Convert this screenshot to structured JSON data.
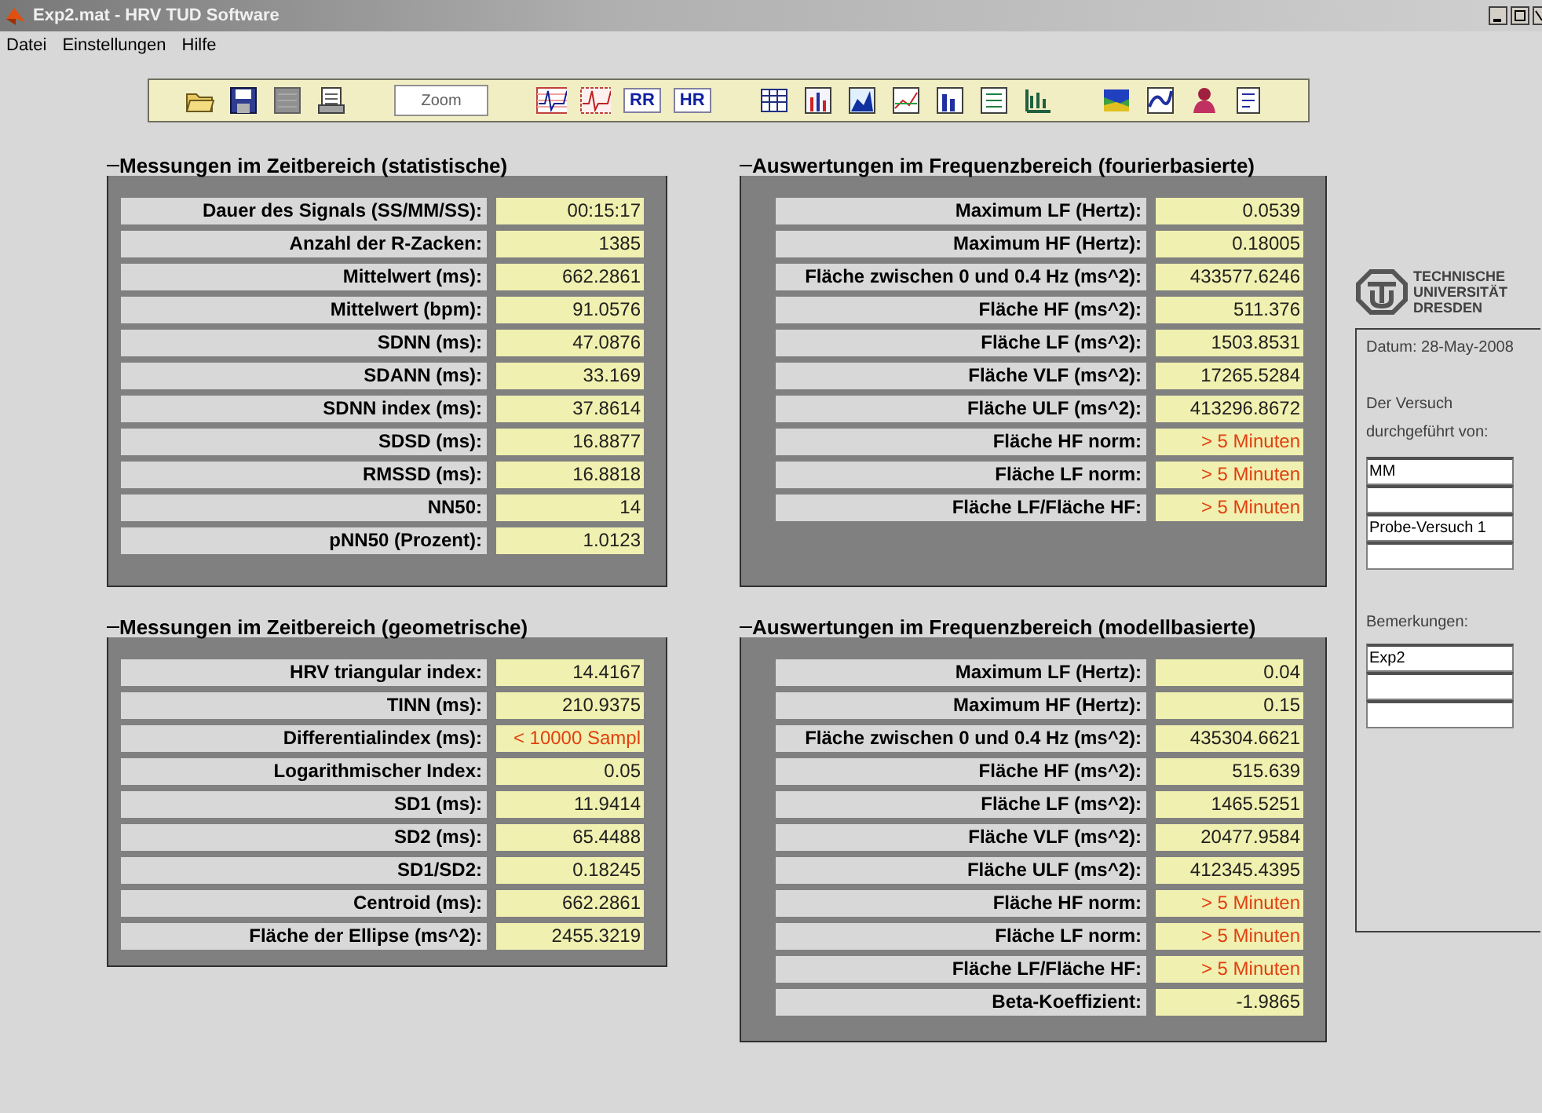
{
  "window": {
    "title": "Exp2.mat - HRV TUD Software"
  },
  "menu": [
    "Datei",
    "Einstellungen",
    "Hilfe"
  ],
  "toolbar": [
    [
      {
        "kind": "icon"
      },
      {
        "kind": "icon"
      },
      {
        "kind": "icon"
      },
      {
        "kind": "icon"
      },
      {
        "kind": "field",
        "label": "Zoom"
      }
    ],
    [
      {
        "kind": "icon"
      },
      {
        "kind": "icon"
      },
      {
        "kind": "text",
        "label": "RR"
      },
      {
        "kind": "text",
        "label": "HR"
      }
    ],
    [
      {
        "kind": "icon"
      },
      {
        "kind": "icon"
      },
      {
        "kind": "icon"
      },
      {
        "kind": "icon"
      },
      {
        "kind": "icon"
      },
      {
        "kind": "icon"
      },
      {
        "kind": "icon"
      }
    ],
    [
      {
        "kind": "icon"
      },
      {
        "kind": "icon"
      },
      {
        "kind": "icon"
      },
      {
        "kind": "icon"
      }
    ]
  ],
  "panels": [
    {
      "title": "Messungen im Zeitbereich (statistische)",
      "rows": [
        {
          "label": "Dauer des Signals (SS/MM/SS):",
          "value": "00:15:17",
          "warning": false
        },
        {
          "label": "Anzahl der R-Zacken:",
          "value": "1385",
          "warning": false
        },
        {
          "label": "Mittelwert (ms):",
          "value": "662.2861",
          "warning": false
        },
        {
          "label": "Mittelwert (bpm):",
          "value": "91.0576",
          "warning": false
        },
        {
          "label": "SDNN (ms):",
          "value": "47.0876",
          "warning": false
        },
        {
          "label": "SDANN (ms):",
          "value": "33.169",
          "warning": false
        },
        {
          "label": "SDNN index (ms):",
          "value": "37.8614",
          "warning": false
        },
        {
          "label": "SDSD (ms):",
          "value": "16.8877",
          "warning": false
        },
        {
          "label": "RMSSD (ms):",
          "value": "16.8818",
          "warning": false
        },
        {
          "label": "NN50:",
          "value": "14",
          "warning": false
        },
        {
          "label": "pNN50 (Prozent):",
          "value": "1.0123",
          "warning": false
        }
      ]
    },
    {
      "title": "Auswertungen im Frequenzbereich (fourierbasierte)",
      "rows": [
        {
          "label": "Maximum LF (Hertz):",
          "value": "0.0539",
          "warning": false
        },
        {
          "label": "Maximum HF (Hertz):",
          "value": "0.18005",
          "warning": false
        },
        {
          "label": "Fläche zwischen 0 und 0.4 Hz (ms^2):",
          "value": "433577.6246",
          "warning": false
        },
        {
          "label": "Fläche HF (ms^2):",
          "value": "511.376",
          "warning": false
        },
        {
          "label": "Fläche LF (ms^2):",
          "value": "1503.8531",
          "warning": false
        },
        {
          "label": "Fläche VLF (ms^2):",
          "value": "17265.5284",
          "warning": false
        },
        {
          "label": "Fläche ULF (ms^2):",
          "value": "413296.8672",
          "warning": false
        },
        {
          "label": "Fläche HF norm:",
          "value": "> 5 Minuten",
          "warning": true
        },
        {
          "label": "Fläche LF norm:",
          "value": "> 5 Minuten",
          "warning": true
        },
        {
          "label": "Fläche LF/Fläche HF:",
          "value": "> 5 Minuten",
          "warning": true
        }
      ]
    },
    {
      "title": "Messungen im Zeitbereich (geometrische)",
      "rows": [
        {
          "label": "HRV triangular index:",
          "value": "14.4167",
          "warning": false
        },
        {
          "label": "TINN (ms):",
          "value": "210.9375",
          "warning": false
        },
        {
          "label": "Differentialindex (ms):",
          "value": "< 10000 Sampl",
          "warning": true
        },
        {
          "label": "Logarithmischer Index:",
          "value": "0.05",
          "warning": false
        },
        {
          "label": "SD1 (ms):",
          "value": "11.9414",
          "warning": false
        },
        {
          "label": "SD2 (ms):",
          "value": "65.4488",
          "warning": false
        },
        {
          "label": "SD1/SD2:",
          "value": "0.18245",
          "warning": false
        },
        {
          "label": "Centroid (ms):",
          "value": "662.2861",
          "warning": false
        },
        {
          "label": "Fläche der Ellipse (ms^2):",
          "value": "2455.3219",
          "warning": false
        }
      ]
    },
    {
      "title": "Auswertungen im Frequenzbereich (modellbasierte)",
      "rows": [
        {
          "label": "Maximum LF (Hertz):",
          "value": "0.04",
          "warning": false
        },
        {
          "label": "Maximum HF (Hertz):",
          "value": "0.15",
          "warning": false
        },
        {
          "label": "Fläche zwischen 0 und 0.4 Hz (ms^2):",
          "value": "435304.6621",
          "warning": false
        },
        {
          "label": "Fläche HF (ms^2):",
          "value": "515.639",
          "warning": false
        },
        {
          "label": "Fläche LF (ms^2):",
          "value": "1465.5251",
          "warning": false
        },
        {
          "label": "Fläche VLF (ms^2):",
          "value": "20477.9584",
          "warning": false
        },
        {
          "label": "Fläche ULF (ms^2):",
          "value": "412345.4395",
          "warning": false
        },
        {
          "label": "Fläche HF norm:",
          "value": "> 5 Minuten",
          "warning": true
        },
        {
          "label": "Fläche LF norm:",
          "value": "> 5 Minuten",
          "warning": true
        },
        {
          "label": "Fläche LF/Fläche HF:",
          "value": "> 5 Minuten",
          "warning": true
        },
        {
          "label": "Beta-Koeffizient:",
          "value": "-1.9865",
          "warning": false
        }
      ]
    }
  ],
  "sidebar": {
    "logo_lines": [
      "TECHNISCHE",
      "UNIVERSITÄT",
      "DRESDEN"
    ],
    "date": "Datum: 28-May-2008",
    "operator_label": "Der Versuch durchgeführt von:",
    "operator_fields": [
      {
        "kind": "text",
        "value": "MM"
      },
      {
        "kind": "empty"
      },
      {
        "kind": "text",
        "value": "Probe-Versuch 1"
      },
      {
        "kind": "empty"
      }
    ],
    "remarks_label": "Bemerkungen:",
    "remarks_fields": [
      {
        "kind": "text",
        "value": "Exp2"
      },
      {
        "kind": "empty"
      },
      {
        "kind": "empty"
      }
    ]
  }
}
